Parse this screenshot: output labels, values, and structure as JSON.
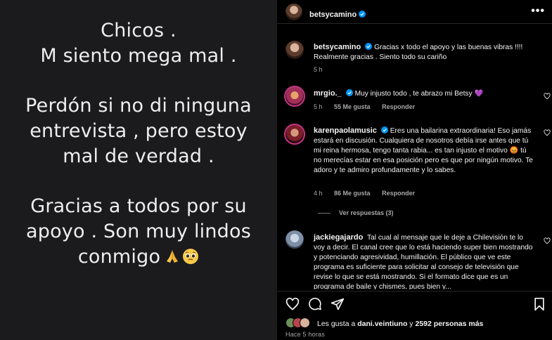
{
  "story": {
    "lines": [
      "Chicos .",
      "M siento mega mal .",
      "Perdón si no di ninguna",
      "entrevista , pero estoy",
      "mal de verdad .",
      "Gracias a todos por su",
      "apoyo . Son muy lindos",
      "conmigo"
    ],
    "emojis": [
      "folded-hands-emoji",
      "pleading-face-emoji"
    ]
  },
  "post": {
    "header_username": "betsycamino",
    "caption": {
      "username": "betsycamino",
      "text_line1": "Gracias x todo el apoyo y las buenas vibras !!!!",
      "text_line2": "Realmente gracias . Siento todo su cariño",
      "time": "5 h"
    },
    "comments": [
      {
        "username": "mrgio._",
        "text": "Muy injusto todo , te abrazo mi Betsy 💜",
        "time": "5 h",
        "likes": "55 Me gusta",
        "reply": "Responder"
      },
      {
        "username": "karenpaolamusic",
        "text": "Eres una bailarina extraordinaria! Eso jamás estará en discusión. Cualquiera de nosotros debía irse antes que tú mi reina hermosa, tengo tanta rabia... es tan injusto el motivo 😡 tú no merecías estar en esa posición pero es que por ningún motivo. Te adoro y te admiro profundamente y lo sabes.",
        "time": "4 h",
        "likes": "86 Me gusta",
        "reply": "Responder",
        "view_replies": "Ver respuestas (3)"
      },
      {
        "username": "jackiegajardo",
        "text": "Tal cual al mensaje que le deje a Chilevisión te lo voy a decir. El canal cree que lo está haciendo super bien mostrando y potenciando agresividad, humillación. El público que ve este programa es suficiente para solicitar al consejo de televisión que revise lo que se está mostrando. Si el formato dice que es un programa de baile y chismes, pues bien y..."
      }
    ],
    "likes_prefix": "Les gusta a ",
    "likes_user": "dani.veintiuno",
    "likes_middle": " y ",
    "likes_count": "2592 personas más",
    "time_ago": "Hace 5 horas"
  },
  "icons": {
    "verified_color": "#0095f6",
    "heart": "heart-icon",
    "comment": "comment-icon",
    "share": "share-icon",
    "save": "bookmark-icon"
  }
}
